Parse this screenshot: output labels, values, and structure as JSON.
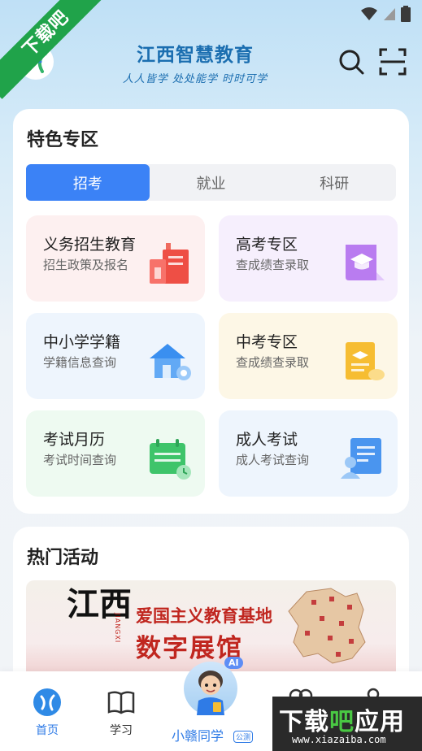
{
  "ribbon": {
    "text": "下载吧"
  },
  "header": {
    "title": "江西智慧教育",
    "slogan": "人人皆学 处处能学 时时可学"
  },
  "featured": {
    "title": "特色专区",
    "tabs": [
      {
        "label": "招考",
        "active": true
      },
      {
        "label": "就业",
        "active": false
      },
      {
        "label": "科研",
        "active": false
      }
    ],
    "tiles": [
      {
        "title": "义务招生教育",
        "subtitle": "招生政策及报名",
        "icon": "school-building-icon",
        "bg": "#fdf0f0"
      },
      {
        "title": "高考专区",
        "subtitle": "查成绩查录取",
        "icon": "graduation-book-icon",
        "bg": "#f6effd"
      },
      {
        "title": "中小学学籍",
        "subtitle": "学籍信息查询",
        "icon": "house-icon",
        "bg": "#eef5fd"
      },
      {
        "title": "中考专区",
        "subtitle": "查成绩查录取",
        "icon": "certificate-icon",
        "bg": "#fdf7e6"
      },
      {
        "title": "考试月历",
        "subtitle": "考试时间查询",
        "icon": "calendar-icon",
        "bg": "#eefaf1"
      },
      {
        "title": "成人考试",
        "subtitle": "成人考试查询",
        "icon": "id-card-icon",
        "bg": "#eef5fd"
      }
    ]
  },
  "hot": {
    "title": "热门活动",
    "banner": {
      "calligraphy": "江西",
      "vertical": "JIANGXI",
      "subtitle": "爱国主义教育基地",
      "main": "数字展馆"
    }
  },
  "tabbar": {
    "items": [
      {
        "label": "首页",
        "icon": "home-logo-icon",
        "active": true
      },
      {
        "label": "学习",
        "icon": "book-icon",
        "active": false
      }
    ],
    "center": {
      "label": "小赣同学",
      "tag": "公测",
      "badge": "AI"
    }
  },
  "watermark": {
    "text_black": "下载",
    "text_green": "吧",
    "text_rest": "应用",
    "url": "www.xiazaiba.com"
  },
  "colors": {
    "accent": "#3b82f6",
    "brand": "#1b6eb0",
    "ribbon": "#20a34a",
    "banner_red": "#c0261f"
  }
}
